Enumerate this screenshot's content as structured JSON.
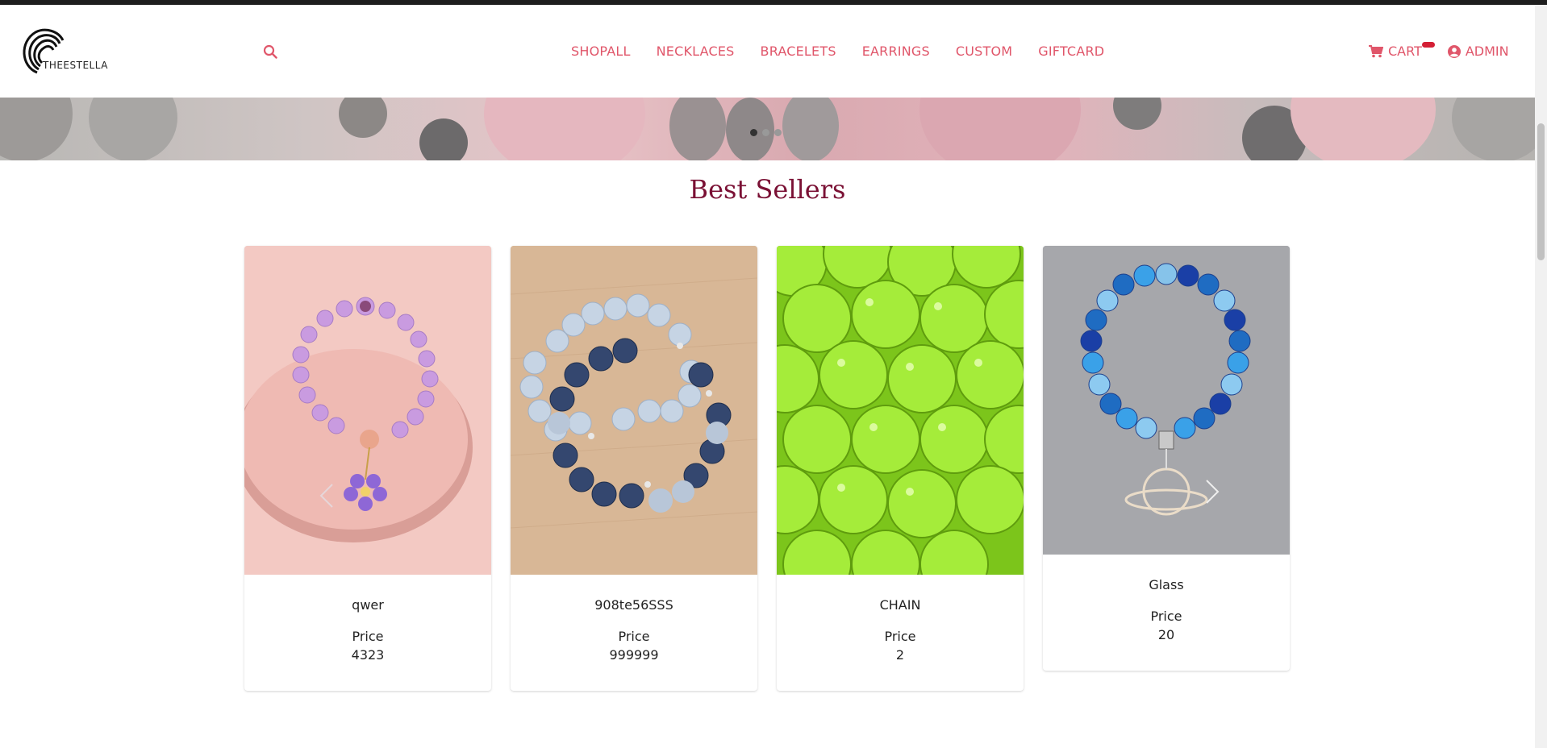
{
  "brand": {
    "name": "THEESTELLA"
  },
  "header": {
    "search_icon": "search-icon",
    "nav": [
      "SHOPALL",
      "NECKLACES",
      "BRACELETS",
      "EARRINGS",
      "CUSTOM",
      "GIFTCARD"
    ],
    "cart_label": "CART",
    "admin_label": "ADMIN",
    "accent_color": "#e0566a",
    "badge_color": "#d41f35"
  },
  "hero": {
    "slides": 3,
    "active_slide": 1
  },
  "best_sellers": {
    "title": "Best Sellers",
    "title_color": "#7a1034",
    "products": [
      {
        "name": "qwer",
        "price_label": "Price",
        "price": "4323"
      },
      {
        "name": "908te56SSS",
        "price_label": "Price",
        "price": "999999"
      },
      {
        "name": "CHAIN",
        "price_label": "Price",
        "price": "2"
      },
      {
        "name": "Glass",
        "price_label": "Price",
        "price": "20"
      }
    ]
  }
}
